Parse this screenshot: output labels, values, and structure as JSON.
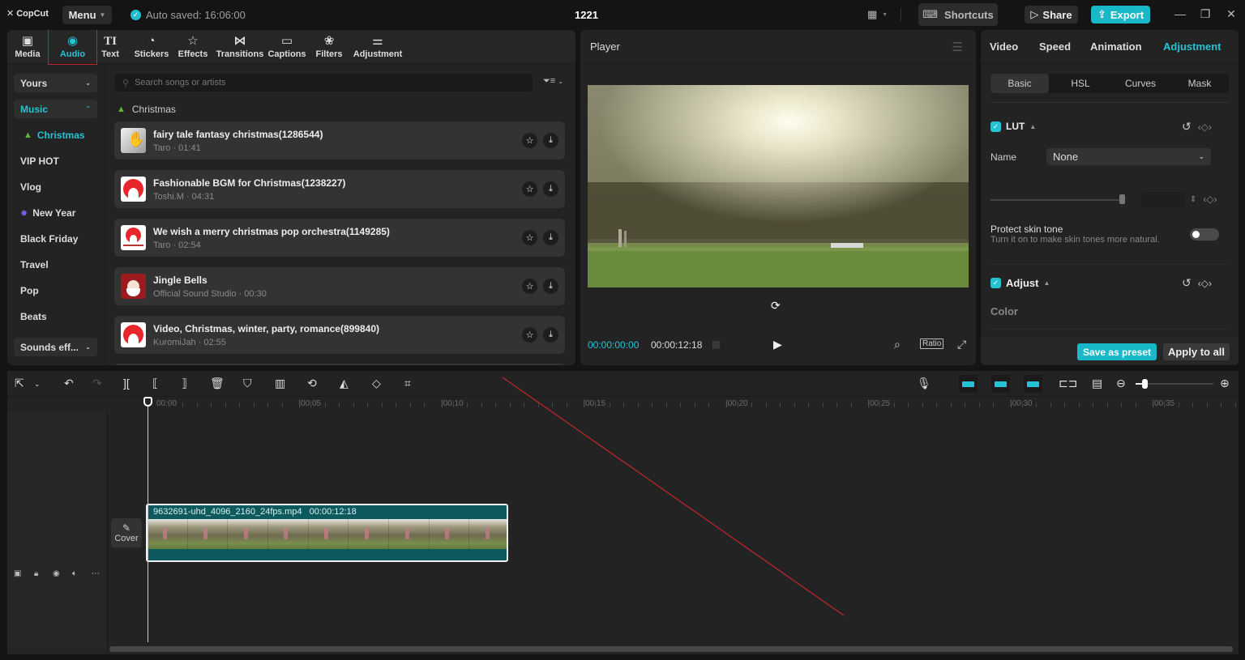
{
  "app": {
    "logo": "CopCut",
    "menu_label": "Menu",
    "autosave": "Auto saved: 16:06:00",
    "project_title": "1221",
    "shortcuts_label": "Shortcuts",
    "share_label": "Share",
    "export_label": "Export",
    "accent_color": "#25c2d3"
  },
  "media_tabs": [
    {
      "label": "Media",
      "icon": "media-icon"
    },
    {
      "label": "Audio",
      "icon": "audio-icon",
      "active": true
    },
    {
      "label": "Text",
      "icon": "text-icon"
    },
    {
      "label": "Stickers",
      "icon": "sticker-icon"
    },
    {
      "label": "Effects",
      "icon": "effects-icon"
    },
    {
      "label": "Transitions",
      "icon": "transitions-icon"
    },
    {
      "label": "Captions",
      "icon": "captions-icon"
    },
    {
      "label": "Filters",
      "icon": "filters-icon"
    },
    {
      "label": "Adjustment",
      "icon": "adjustment-icon"
    }
  ],
  "audio_sidebar": {
    "yours_label": "Yours",
    "music_label": "Music",
    "categories": [
      "Christmas",
      "VIP HOT",
      "Vlog",
      "New Year",
      "Black Friday",
      "Travel",
      "Pop",
      "Beats"
    ],
    "active_category": "Christmas",
    "sounds_label": "Sounds eff..."
  },
  "search": {
    "placeholder": "Search songs or artists",
    "value": ""
  },
  "section_title": "Christmas",
  "songs": [
    {
      "title": "fairy tale fantasy christmas(1286544)",
      "meta": "Taro · 01:41"
    },
    {
      "title": "Fashionable BGM for Christmas(1238227)",
      "meta": "Toshi.M · 04:31"
    },
    {
      "title": "We wish a merry christmas pop orchestra(1149285)",
      "meta": "Taro · 02:54"
    },
    {
      "title": "Jingle Bells",
      "meta": "Official Sound Studio · 00:30"
    },
    {
      "title": "Video, Christmas, winter, party, romance(899840)",
      "meta": "KuromiJah · 02:55"
    }
  ],
  "player": {
    "title": "Player",
    "current_time": "00:00:00:00",
    "duration": "00:00:12:18",
    "ratio_label": "Ratio"
  },
  "inspector": {
    "tabs": [
      "Video",
      "Speed",
      "Animation",
      "Adjustment"
    ],
    "active_tab": "Adjustment",
    "subtabs": [
      "Basic",
      "HSL",
      "Curves",
      "Mask"
    ],
    "active_subtab": "Basic",
    "lut": {
      "label": "LUT",
      "enabled": true,
      "name_label": "Name",
      "name_value": "None"
    },
    "protect_skin": {
      "label": "Protect skin tone",
      "description": "Turn it on to make skin tones more natural.",
      "enabled": false
    },
    "adjust": {
      "label": "Adjust",
      "enabled": true,
      "color_label": "Color"
    },
    "save_preset_label": "Save as preset",
    "apply_all_label": "Apply to all"
  },
  "timeline": {
    "ruler_labels": [
      "00:00",
      "00:05",
      "00:10",
      "00:15",
      "00:20",
      "00:25",
      "00:30",
      "00:35"
    ],
    "clip": {
      "filename": "9632691-uhd_4096_2160_24fps.mp4",
      "duration": "00:00:12:18"
    },
    "cover_label": "Cover",
    "zoom_level": 0.12
  }
}
